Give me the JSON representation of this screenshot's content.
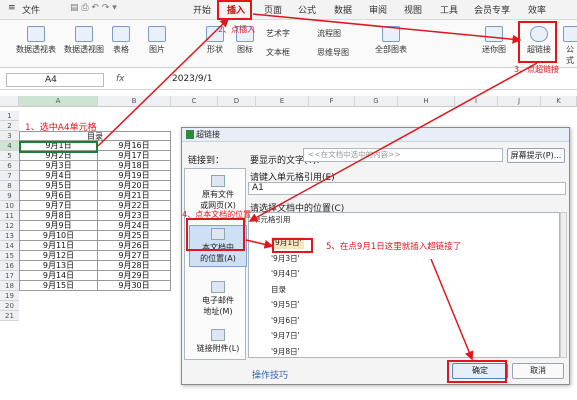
{
  "tabs": {
    "file": "文件",
    "start": "开始",
    "insert": "插入",
    "page": "页面",
    "formula": "公式",
    "data": "数据",
    "review": "审阅",
    "view": "视图",
    "tools": "工具",
    "member": "会员专享",
    "efficiency": "效率"
  },
  "ribbon": {
    "pivot_table": "数据透视表",
    "pivot_chart": "数据透视图",
    "table": "表格",
    "picture": "图片",
    "shape": "形状",
    "icon": "图标",
    "art_text": "艺术字",
    "textbox": "文本框",
    "flowchart": "流程图",
    "mindmap": "思维导图",
    "all_charts": "全部图表",
    "sparkline": "迷你图",
    "hyperlink": "超链接",
    "public": "公式"
  },
  "formula_bar": {
    "cell_ref": "A4",
    "fx": "fx",
    "value": "2023/9/1"
  },
  "sheet": {
    "columns": [
      "A",
      "B",
      "C",
      "D",
      "E",
      "F",
      "G",
      "H",
      "I",
      "J",
      "K"
    ],
    "title": "目录",
    "col_a": [
      "9月1日",
      "9月2日",
      "9月3日",
      "9月4日",
      "9月5日",
      "9月6日",
      "9月7日",
      "9月8日",
      "9月9日",
      "9月10日",
      "9月11日",
      "9月12日",
      "9月13日",
      "9月14日",
      "9月15日"
    ],
    "col_b": [
      "9月16日",
      "9月17日",
      "9月18日",
      "9月19日",
      "9月20日",
      "9月21日",
      "9月22日",
      "9月23日",
      "9月24日",
      "9月25日",
      "9月26日",
      "9月27日",
      "9月28日",
      "9月29日",
      "9月30日"
    ],
    "rows": [
      "1",
      "2",
      "3",
      "4",
      "5",
      "6",
      "7",
      "8",
      "9",
      "10",
      "11",
      "12",
      "13",
      "14",
      "15",
      "16",
      "17",
      "18",
      "19",
      "20",
      "21"
    ]
  },
  "dialog": {
    "title": "超链接",
    "link_to": "链接到：",
    "display_text_label": "要显示的文字(T):",
    "display_text_placeholder": "<<在文档中选中的内容>>",
    "screentip": "屏幕提示(P)...",
    "nav": {
      "existing": "原有文件\n或网页(X)",
      "document": "本文档中\n的位置(A)",
      "email": "电子邮件\n地址(M)",
      "attach": "链接附件(L)"
    },
    "cell_ref_label": "请键入单元格引用(E)",
    "cell_ref_value": "A1",
    "location_label": "请选择文档中的位置(C)",
    "tree_header": "单元格引用",
    "list": [
      "'9月1日'",
      "'9月3日'",
      "'9月4日'",
      "目录",
      "'9月5日'",
      "'9月6日'",
      "'9月7日'",
      "'9月8日'",
      "'9月10日'"
    ],
    "ops": "操作技巧",
    "ok": "确定",
    "cancel": "取消"
  },
  "annotations": {
    "step1": "1、选中A4单元格",
    "step2": "2、点插入",
    "step3": "3、点超链接",
    "step4": "4、点本文档的位置",
    "step5": "5、在点9月1日这里就插入超链接了"
  },
  "colors": {
    "accent": "#e0161b",
    "selection": "#1e7e34"
  }
}
